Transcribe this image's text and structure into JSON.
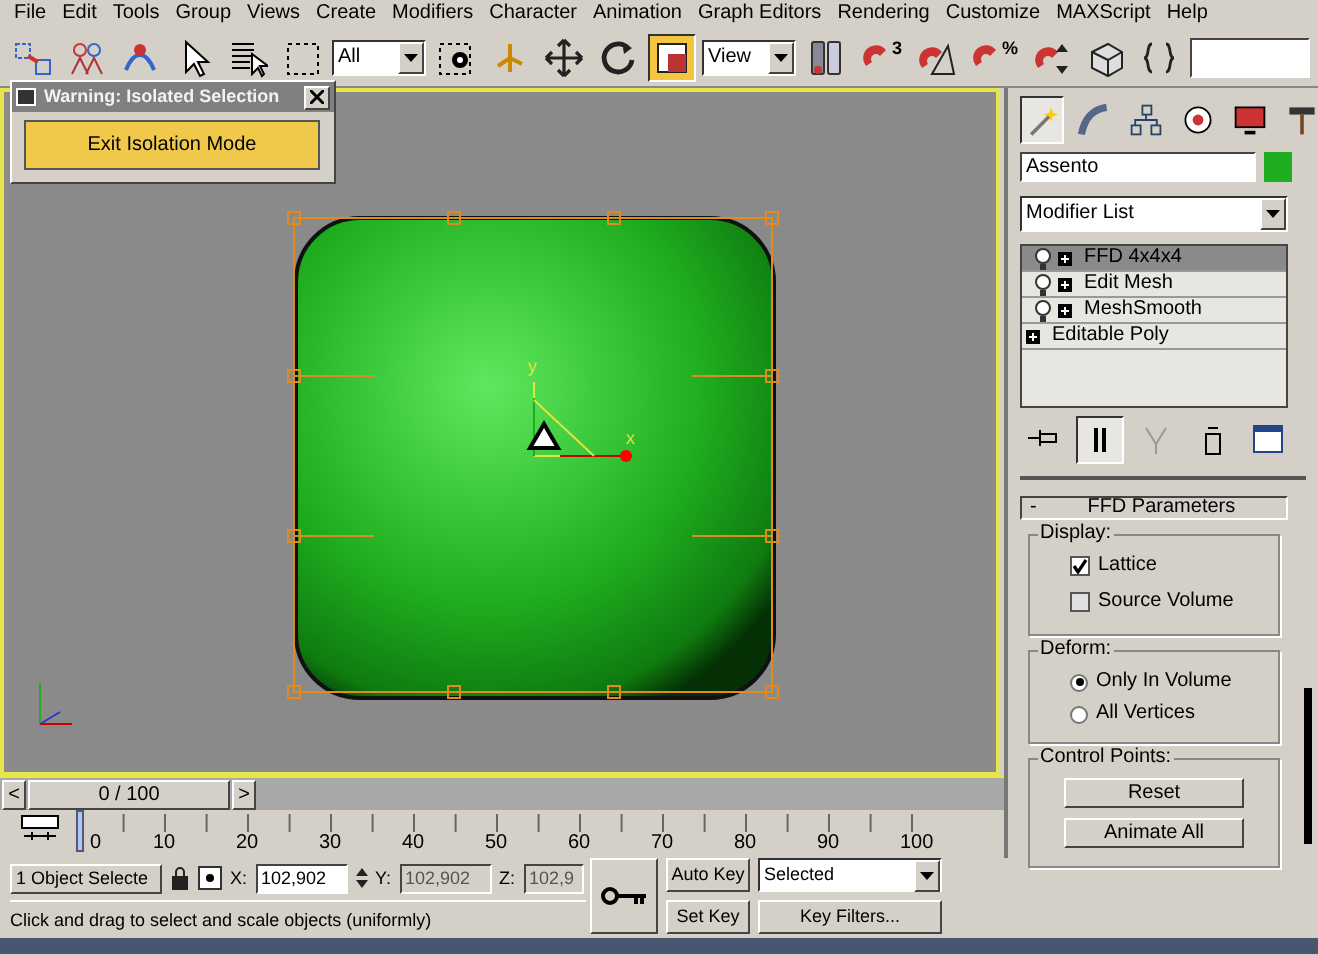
{
  "menu": [
    "File",
    "Edit",
    "Tools",
    "Group",
    "Views",
    "Create",
    "Modifiers",
    "Character",
    "Animation",
    "Graph Editors",
    "Rendering",
    "Customize",
    "MAXScript",
    "Help"
  ],
  "toolbar": {
    "tools": [
      {
        "kind": "link",
        "selected": false
      },
      {
        "kind": "unlink",
        "selected": false
      },
      {
        "kind": "bind",
        "selected": false
      },
      {
        "kind": "pointer",
        "selected": false
      },
      {
        "kind": "select-list",
        "selected": false
      },
      {
        "kind": "region",
        "selected": false
      },
      {
        "kind": "dropdown",
        "value": "All"
      },
      {
        "kind": "window",
        "selected": false
      },
      {
        "kind": "manipulate",
        "selected": false
      },
      {
        "kind": "move",
        "selected": false
      },
      {
        "kind": "rotate",
        "selected": false
      },
      {
        "kind": "scale",
        "selected": true
      },
      {
        "kind": "dropdown",
        "value": "View"
      },
      {
        "kind": "pivot",
        "selected": false
      },
      {
        "kind": "snap",
        "label": "3",
        "selected": false
      },
      {
        "kind": "angle-snap",
        "selected": false
      },
      {
        "kind": "snap",
        "label": "%",
        "selected": false
      },
      {
        "kind": "spinner-snap",
        "selected": false
      },
      {
        "kind": "named-sets",
        "selected": false
      },
      {
        "kind": "edit-sets",
        "selected": false
      },
      {
        "kind": "field"
      }
    ]
  },
  "dialog": {
    "title": "Warning: Isolated Selection",
    "button": "Exit Isolation Mode"
  },
  "viewport": {
    "active": true,
    "gizmo_labels": [
      "y",
      "x"
    ]
  },
  "time_slider": {
    "label": "0 / 100",
    "prev": "<",
    "next": ">",
    "level": 0
  },
  "ruler": {
    "labels": [
      "0",
      "10",
      "20",
      "30",
      "40",
      "50",
      "60",
      "70",
      "80",
      "90",
      "100"
    ]
  },
  "command_panel": {
    "tabs": [
      {
        "kind": "create",
        "selected": true
      },
      {
        "kind": "modify",
        "selected": false
      },
      {
        "kind": "hierarchy",
        "selected": false
      },
      {
        "kind": "motion",
        "selected": false
      },
      {
        "kind": "display",
        "selected": false
      },
      {
        "kind": "utilities",
        "selected": false
      }
    ],
    "object": {
      "name": "Assento",
      "color": "#1fae1f"
    },
    "modifier_list": "Modifier List",
    "stack": [
      {
        "label": "FFD 4x4x4",
        "kind": "modifier",
        "selected": true
      },
      {
        "label": "Edit Mesh",
        "kind": "modifier",
        "selected": false
      },
      {
        "label": "MeshSmooth",
        "kind": "modifier",
        "selected": false
      },
      {
        "label": "Editable Poly",
        "kind": "base",
        "selected": false
      }
    ],
    "stack_tools": [
      {
        "kind": "pin",
        "selected": false
      },
      {
        "kind": "end-result",
        "selected": true
      },
      {
        "kind": "unique",
        "selected": false
      },
      {
        "kind": "remove",
        "selected": false
      },
      {
        "kind": "configure",
        "selected": false
      }
    ],
    "rollout": {
      "toggle": "-",
      "title": "FFD Parameters",
      "groups": [
        {
          "title": "Display:",
          "controls": [
            {
              "kind": "checkbox",
              "label": "Lattice",
              "checked": true
            },
            {
              "kind": "checkbox",
              "label": "Source Volume",
              "checked": false
            }
          ]
        },
        {
          "title": "Deform:",
          "controls": [
            {
              "kind": "radio",
              "label": "Only In Volume",
              "selected": true
            },
            {
              "kind": "radio",
              "label": "All Vertices",
              "selected": false
            }
          ]
        },
        {
          "title": "Control Points:",
          "controls": [
            {
              "kind": "button",
              "label": "Reset"
            },
            {
              "kind": "button",
              "label": "Animate All"
            }
          ]
        }
      ]
    }
  },
  "status": {
    "selection": "1 Object Selecte",
    "coords": [
      {
        "axis": "X:",
        "value": "102,902",
        "disabled": false
      },
      {
        "axis": "Y:",
        "value": "102,902",
        "disabled": true
      },
      {
        "axis": "Z:",
        "value": "102,9",
        "disabled": true
      }
    ],
    "prompt": "Click and drag to select and scale objects (uniformly)",
    "auto_key": "Auto Key",
    "set_key": "Set Key",
    "key_mode": "Selected",
    "key_filters": "Key Filters..."
  }
}
